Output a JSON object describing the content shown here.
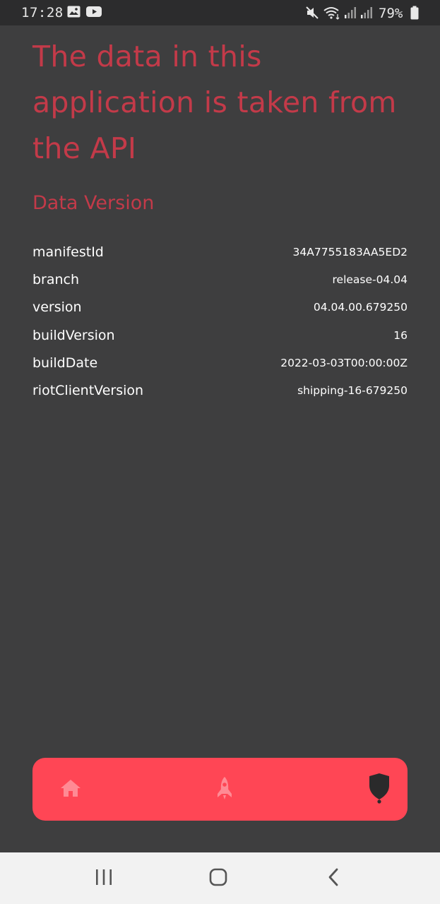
{
  "status_bar": {
    "time": "17:28",
    "battery": "79%",
    "icons": [
      "gallery-icon",
      "youtube-icon",
      "mute-icon",
      "wifi-icon",
      "signal-icon",
      "signal-icon",
      "battery-icon"
    ]
  },
  "content": {
    "headline": "The data in this application is taken from the API",
    "section_title": "Data Version",
    "rows": [
      {
        "key": "manifestId",
        "value": "34A7755183AA5ED2"
      },
      {
        "key": "branch",
        "value": "release-04.04"
      },
      {
        "key": "version",
        "value": "04.04.00.679250"
      },
      {
        "key": "buildVersion",
        "value": "16"
      },
      {
        "key": "buildDate",
        "value": "2022-03-03T00:00:00Z"
      },
      {
        "key": "riotClientVersion",
        "value": "shipping-16-679250"
      }
    ]
  },
  "bottom_nav": {
    "items": [
      {
        "icon": "home-icon",
        "active": false
      },
      {
        "icon": "rocket-icon",
        "active": false
      },
      {
        "icon": "shield-icon",
        "active": true
      }
    ]
  },
  "system_nav": {
    "buttons": [
      "recents-icon",
      "home-button-icon",
      "back-icon"
    ]
  },
  "colors": {
    "background": "#3e3e3f",
    "accent": "#c33a49",
    "nav_bar": "#ff4655",
    "nav_icon_inactive": "#ff8a94",
    "nav_icon_active": "#2a2a2b"
  }
}
